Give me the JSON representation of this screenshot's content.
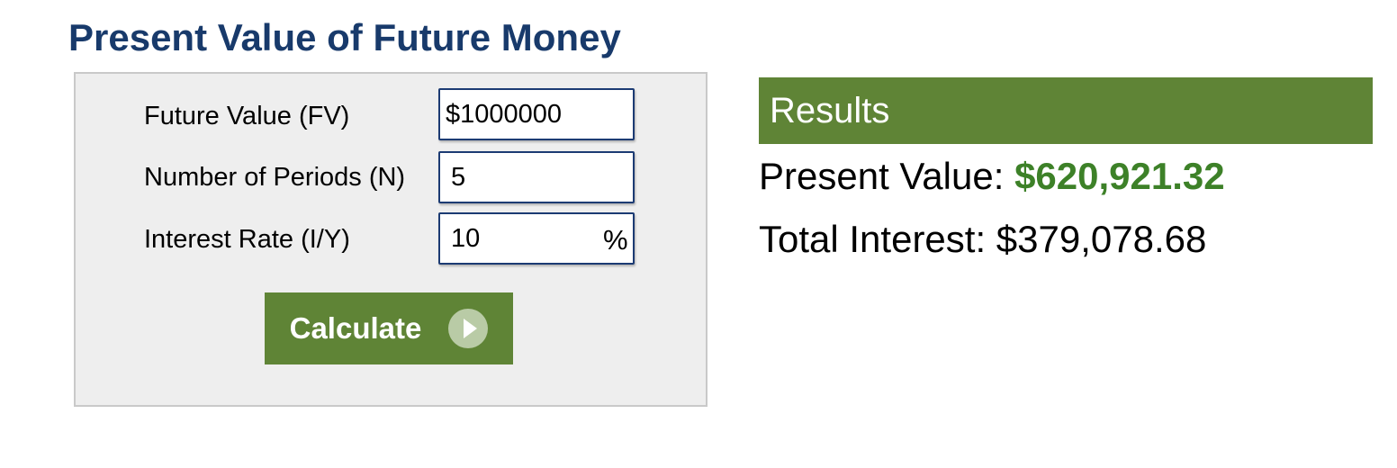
{
  "page": {
    "title": "Present Value of Future Money"
  },
  "form": {
    "future_value": {
      "label": "Future Value (FV)",
      "value": "$1000000"
    },
    "periods": {
      "label": "Number of Periods (N)",
      "value": "5"
    },
    "interest_rate": {
      "label": "Interest Rate (I/Y)",
      "value": "10",
      "suffix": "%"
    },
    "calculate_label": "Calculate",
    "calculate_icon": "arrow-right-circle-icon"
  },
  "results": {
    "title": "Results",
    "present_value_label": "Present Value:",
    "present_value": "$620,921.32",
    "total_interest_label": "Total Interest:",
    "total_interest": "$379,078.68"
  },
  "colors": {
    "title": "#183a6b",
    "accent_green": "#5f8436",
    "value_green": "#3d8128",
    "panel_bg": "#eeeeee",
    "input_border": "#1c3b73"
  }
}
